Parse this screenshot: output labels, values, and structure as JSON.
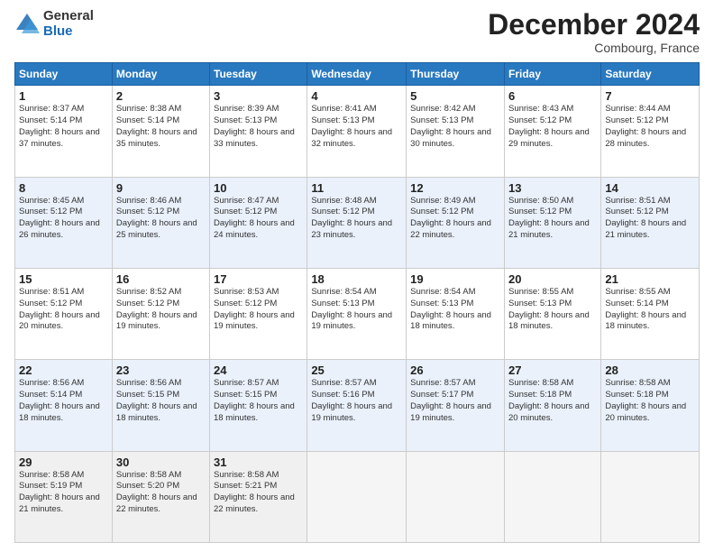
{
  "logo": {
    "general": "General",
    "blue": "Blue"
  },
  "title": "December 2024",
  "location": "Combourg, France",
  "header_days": [
    "Sunday",
    "Monday",
    "Tuesday",
    "Wednesday",
    "Thursday",
    "Friday",
    "Saturday"
  ],
  "weeks": [
    [
      {
        "day": "1",
        "sunrise": "Sunrise: 8:37 AM",
        "sunset": "Sunset: 5:14 PM",
        "daylight": "Daylight: 8 hours and 37 minutes."
      },
      {
        "day": "2",
        "sunrise": "Sunrise: 8:38 AM",
        "sunset": "Sunset: 5:14 PM",
        "daylight": "Daylight: 8 hours and 35 minutes."
      },
      {
        "day": "3",
        "sunrise": "Sunrise: 8:39 AM",
        "sunset": "Sunset: 5:13 PM",
        "daylight": "Daylight: 8 hours and 33 minutes."
      },
      {
        "day": "4",
        "sunrise": "Sunrise: 8:41 AM",
        "sunset": "Sunset: 5:13 PM",
        "daylight": "Daylight: 8 hours and 32 minutes."
      },
      {
        "day": "5",
        "sunrise": "Sunrise: 8:42 AM",
        "sunset": "Sunset: 5:13 PM",
        "daylight": "Daylight: 8 hours and 30 minutes."
      },
      {
        "day": "6",
        "sunrise": "Sunrise: 8:43 AM",
        "sunset": "Sunset: 5:12 PM",
        "daylight": "Daylight: 8 hours and 29 minutes."
      },
      {
        "day": "7",
        "sunrise": "Sunrise: 8:44 AM",
        "sunset": "Sunset: 5:12 PM",
        "daylight": "Daylight: 8 hours and 28 minutes."
      }
    ],
    [
      {
        "day": "8",
        "sunrise": "Sunrise: 8:45 AM",
        "sunset": "Sunset: 5:12 PM",
        "daylight": "Daylight: 8 hours and 26 minutes."
      },
      {
        "day": "9",
        "sunrise": "Sunrise: 8:46 AM",
        "sunset": "Sunset: 5:12 PM",
        "daylight": "Daylight: 8 hours and 25 minutes."
      },
      {
        "day": "10",
        "sunrise": "Sunrise: 8:47 AM",
        "sunset": "Sunset: 5:12 PM",
        "daylight": "Daylight: 8 hours and 24 minutes."
      },
      {
        "day": "11",
        "sunrise": "Sunrise: 8:48 AM",
        "sunset": "Sunset: 5:12 PM",
        "daylight": "Daylight: 8 hours and 23 minutes."
      },
      {
        "day": "12",
        "sunrise": "Sunrise: 8:49 AM",
        "sunset": "Sunset: 5:12 PM",
        "daylight": "Daylight: 8 hours and 22 minutes."
      },
      {
        "day": "13",
        "sunrise": "Sunrise: 8:50 AM",
        "sunset": "Sunset: 5:12 PM",
        "daylight": "Daylight: 8 hours and 21 minutes."
      },
      {
        "day": "14",
        "sunrise": "Sunrise: 8:51 AM",
        "sunset": "Sunset: 5:12 PM",
        "daylight": "Daylight: 8 hours and 21 minutes."
      }
    ],
    [
      {
        "day": "15",
        "sunrise": "Sunrise: 8:51 AM",
        "sunset": "Sunset: 5:12 PM",
        "daylight": "Daylight: 8 hours and 20 minutes."
      },
      {
        "day": "16",
        "sunrise": "Sunrise: 8:52 AM",
        "sunset": "Sunset: 5:12 PM",
        "daylight": "Daylight: 8 hours and 19 minutes."
      },
      {
        "day": "17",
        "sunrise": "Sunrise: 8:53 AM",
        "sunset": "Sunset: 5:12 PM",
        "daylight": "Daylight: 8 hours and 19 minutes."
      },
      {
        "day": "18",
        "sunrise": "Sunrise: 8:54 AM",
        "sunset": "Sunset: 5:13 PM",
        "daylight": "Daylight: 8 hours and 19 minutes."
      },
      {
        "day": "19",
        "sunrise": "Sunrise: 8:54 AM",
        "sunset": "Sunset: 5:13 PM",
        "daylight": "Daylight: 8 hours and 18 minutes."
      },
      {
        "day": "20",
        "sunrise": "Sunrise: 8:55 AM",
        "sunset": "Sunset: 5:13 PM",
        "daylight": "Daylight: 8 hours and 18 minutes."
      },
      {
        "day": "21",
        "sunrise": "Sunrise: 8:55 AM",
        "sunset": "Sunset: 5:14 PM",
        "daylight": "Daylight: 8 hours and 18 minutes."
      }
    ],
    [
      {
        "day": "22",
        "sunrise": "Sunrise: 8:56 AM",
        "sunset": "Sunset: 5:14 PM",
        "daylight": "Daylight: 8 hours and 18 minutes."
      },
      {
        "day": "23",
        "sunrise": "Sunrise: 8:56 AM",
        "sunset": "Sunset: 5:15 PM",
        "daylight": "Daylight: 8 hours and 18 minutes."
      },
      {
        "day": "24",
        "sunrise": "Sunrise: 8:57 AM",
        "sunset": "Sunset: 5:15 PM",
        "daylight": "Daylight: 8 hours and 18 minutes."
      },
      {
        "day": "25",
        "sunrise": "Sunrise: 8:57 AM",
        "sunset": "Sunset: 5:16 PM",
        "daylight": "Daylight: 8 hours and 19 minutes."
      },
      {
        "day": "26",
        "sunrise": "Sunrise: 8:57 AM",
        "sunset": "Sunset: 5:17 PM",
        "daylight": "Daylight: 8 hours and 19 minutes."
      },
      {
        "day": "27",
        "sunrise": "Sunrise: 8:58 AM",
        "sunset": "Sunset: 5:18 PM",
        "daylight": "Daylight: 8 hours and 20 minutes."
      },
      {
        "day": "28",
        "sunrise": "Sunrise: 8:58 AM",
        "sunset": "Sunset: 5:18 PM",
        "daylight": "Daylight: 8 hours and 20 minutes."
      }
    ],
    [
      {
        "day": "29",
        "sunrise": "Sunrise: 8:58 AM",
        "sunset": "Sunset: 5:19 PM",
        "daylight": "Daylight: 8 hours and 21 minutes."
      },
      {
        "day": "30",
        "sunrise": "Sunrise: 8:58 AM",
        "sunset": "Sunset: 5:20 PM",
        "daylight": "Daylight: 8 hours and 22 minutes."
      },
      {
        "day": "31",
        "sunrise": "Sunrise: 8:58 AM",
        "sunset": "Sunset: 5:21 PM",
        "daylight": "Daylight: 8 hours and 22 minutes."
      },
      null,
      null,
      null,
      null
    ]
  ]
}
